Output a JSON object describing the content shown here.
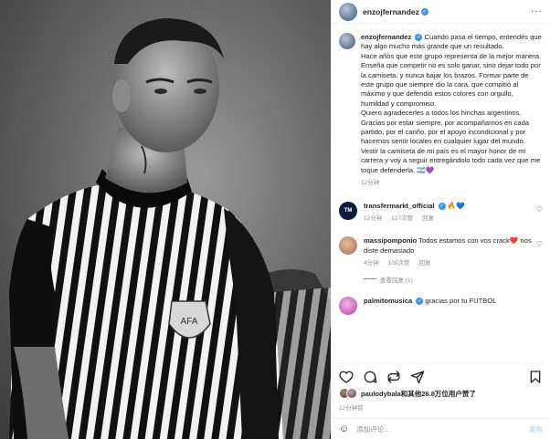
{
  "post": {
    "username": "enzojfernandez",
    "more_label": "···"
  },
  "caption": {
    "username": "enzojfernandez",
    "paragraphs": [
      "Cuando pasa el tiempo, entendés que hay algo mucho más grande que un resultado.",
      "Hace años que este grupo representa de la mejor manera. Enseña que competir no es solo ganar, sino dejar todo por la camiseta, y nunca bajar los brazos. Formar parte de este grupo que siempre dio la cara, que compitió al máximo y que defendió estos colores con orgullo, humildad y compromiso.",
      "Quiero agradecerles a todos los hinchas argentinos. Gracias por estar siempre, por acompañarnos en cada partido, por el cariño, por el apoyo incondicional y por hacernos sentir locales en cualquier lugar del mundo.",
      "Vestir la camiseta de mi país es el mayor honor de mi carrera y voy a seguir entregándolo todo cada vez que me toque defenderla. 🇦🇷💜"
    ],
    "time": "12分钟"
  },
  "comments": [
    {
      "username": "transfermarkt_official",
      "text": "🔥💙",
      "time": "12分钟",
      "likes": "127次赞",
      "reply": "回复",
      "avatar_color": "#0d1b3e",
      "avatar_label": "TM"
    },
    {
      "username": "massipomponio",
      "text": "Todos estamos con vos crack❤️  nos diste demasiado",
      "time": "4分钟",
      "likes": "109次赞",
      "reply": "回复",
      "view_replies": "查看回复 (1)",
      "avatar_color": "#d9a487"
    },
    {
      "username": "palmitomusica",
      "text": "gracias por tu FUTBOL",
      "avatar_color": "#e37fd0"
    }
  ],
  "likes": {
    "user": "paulodybala",
    "rest": "和其他26.8万位用户赞了"
  },
  "post_time": "12分钟前",
  "add_comment": {
    "placeholder": "添加评论...",
    "post_label": "发布"
  },
  "icons": [
    "heart-icon",
    "comment-icon",
    "share-icon",
    "send-icon",
    "bookmark-icon",
    "emoji-icon",
    "verified-icon",
    "more-icon"
  ]
}
